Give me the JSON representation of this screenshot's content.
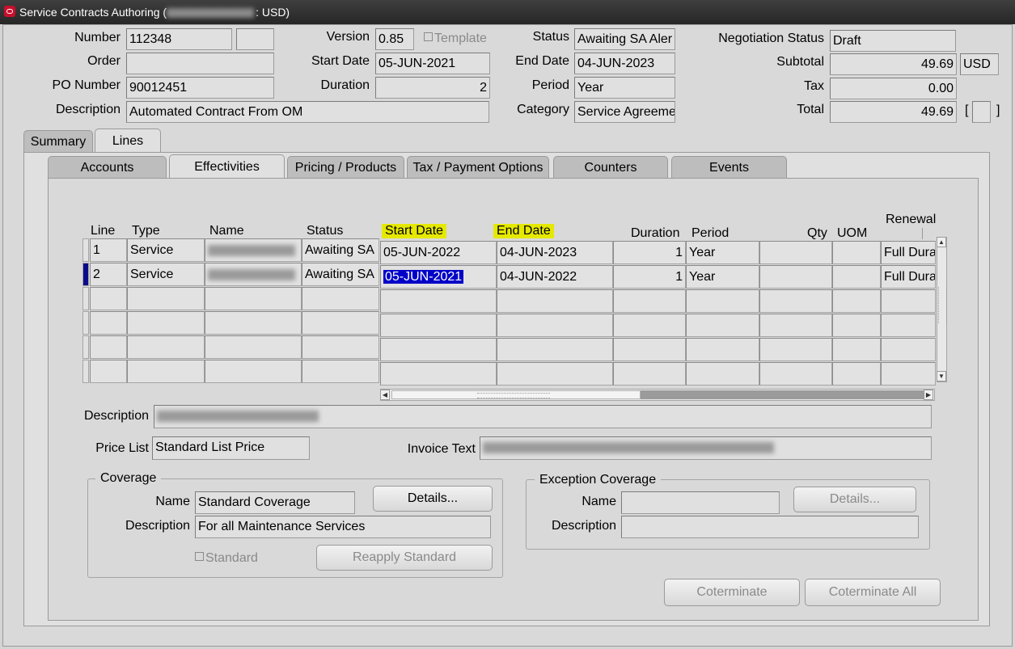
{
  "window": {
    "title_prefix": "Service Contracts Authoring (",
    "title_suffix": ": USD)"
  },
  "header": {
    "number_label": "Number",
    "number_value": "112348",
    "number_ext": "",
    "order_label": "Order",
    "order_value": "",
    "po_label": "PO Number",
    "po_value": "90012451",
    "desc_label": "Description",
    "desc_value": "Automated Contract From OM",
    "version_label": "Version",
    "version_value": "0.85",
    "template_label": "Template",
    "start_label": "Start Date",
    "start_value": "05-JUN-2021",
    "duration_label": "Duration",
    "duration_value": "2",
    "status_label": "Status",
    "status_value": "Awaiting SA Aler",
    "end_label": "End Date",
    "end_value": "04-JUN-2023",
    "period_label": "Period",
    "period_value": "Year",
    "category_label": "Category",
    "category_value": "Service Agreeme",
    "neg_label": "Negotiation Status",
    "neg_value": "Draft",
    "subtotal_label": "Subtotal",
    "subtotal_value": "49.69",
    "currency": "USD",
    "tax_label": "Tax",
    "tax_value": "0.00",
    "total_label": "Total",
    "total_value": "49.69",
    "bracket_open": "[",
    "bracket_close": "]"
  },
  "top_tabs": [
    "Summary",
    "Lines"
  ],
  "sub_tabs": [
    "Accounts",
    "Effectivities",
    "Pricing / Products",
    "Tax / Payment Options",
    "Counters",
    "Events"
  ],
  "grid": {
    "headers": {
      "line": "Line",
      "type": "Type",
      "name": "Name",
      "status": "Status",
      "start": "Start Date",
      "end": "End Date",
      "duration": "Duration",
      "period": "Period",
      "qty": "Qty",
      "uom": "UOM",
      "renewal": "Renewal"
    },
    "rows": [
      {
        "line": "1",
        "type": "Service",
        "status": "Awaiting SA",
        "start": "05-JUN-2022",
        "end": "04-JUN-2023",
        "duration": "1",
        "period": "Year",
        "renewal": "Full Dura"
      },
      {
        "line": "2",
        "type": "Service",
        "status": "Awaiting SA",
        "start": "05-JUN-2021",
        "end": "04-JUN-2022",
        "duration": "1",
        "period": "Year",
        "renewal": "Full Dura"
      }
    ]
  },
  "details": {
    "desc_label": "Description",
    "price_list_label": "Price List",
    "price_list_value": "Standard List Price",
    "invoice_label": "Invoice Text"
  },
  "coverage": {
    "title": "Coverage",
    "name_label": "Name",
    "name_value": "Standard Coverage",
    "desc_label": "Description",
    "desc_value": "For all Maintenance Services",
    "details_button": "Details...",
    "standard_label": "Standard",
    "reapply_button": "Reapply Standard"
  },
  "exception": {
    "title": "Exception Coverage",
    "name_label": "Name",
    "name_value": "",
    "desc_label": "Description",
    "desc_value": "",
    "details_button": "Details..."
  },
  "actions": {
    "coterminate": "Coterminate",
    "coterminate_all": "Coterminate All"
  }
}
